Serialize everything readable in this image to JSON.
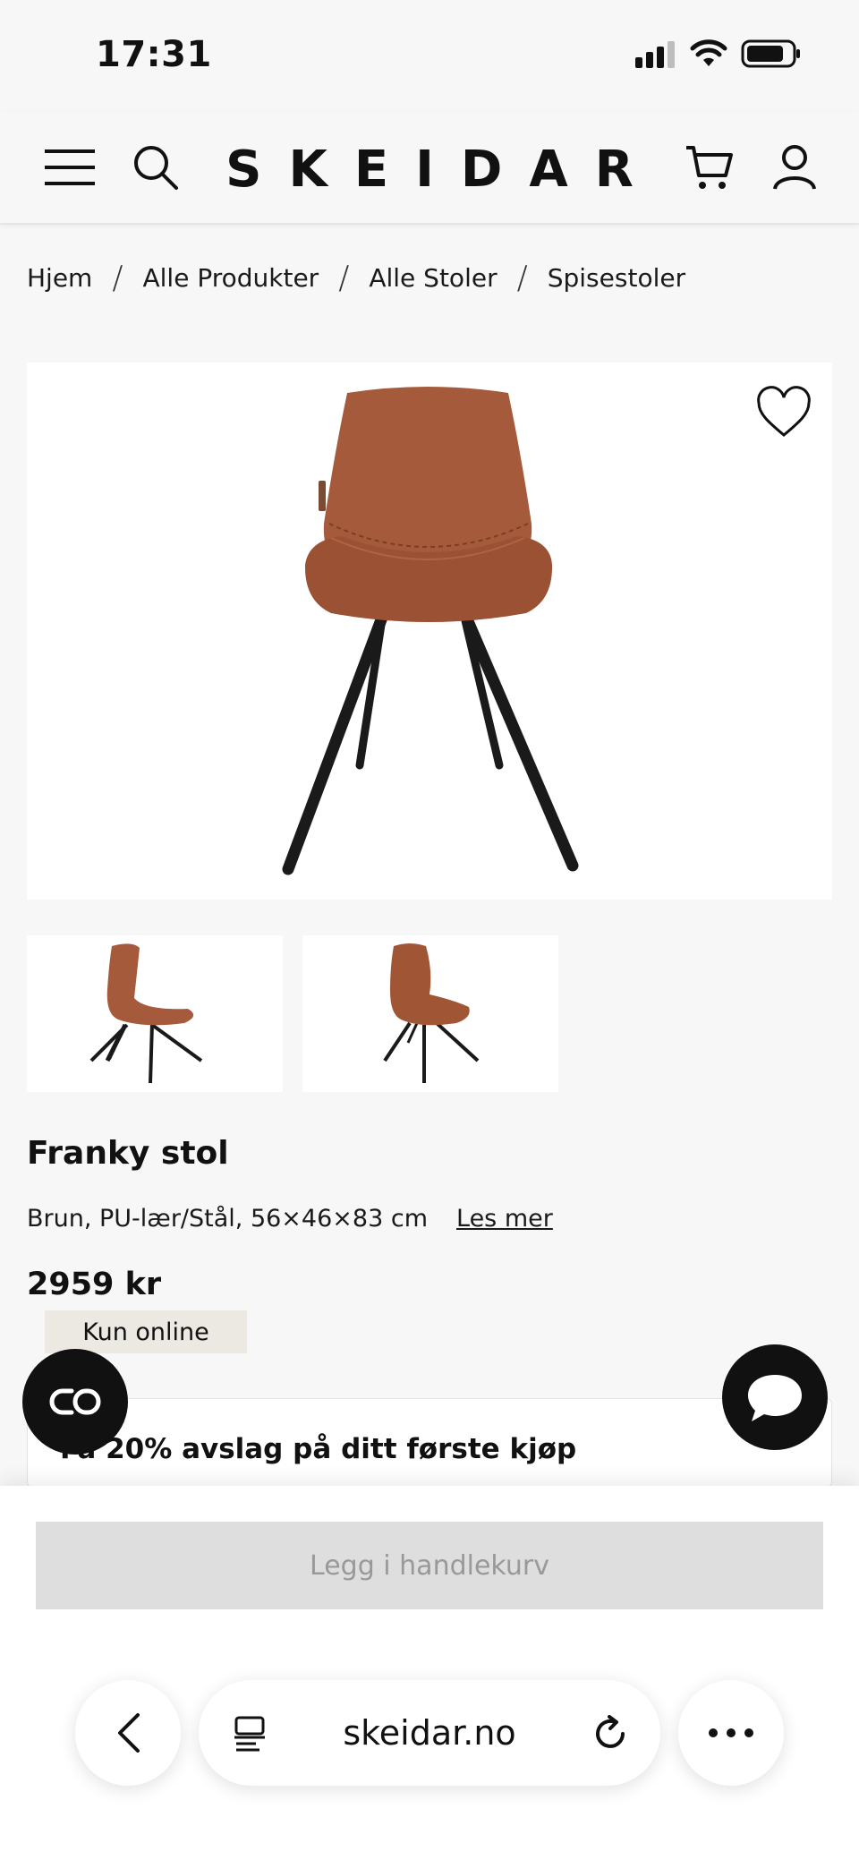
{
  "status_bar": {
    "time": "17:31"
  },
  "header": {
    "logo": "SKEIDAR"
  },
  "breadcrumb": [
    {
      "label": "Hjem"
    },
    {
      "label": "Alle Produkter"
    },
    {
      "label": "Alle Stoler"
    },
    {
      "label": "Spisestoler"
    }
  ],
  "product": {
    "title": "Franky stol",
    "description": "Brun, PU-lær/Stål, 56×46×83 cm",
    "read_more": "Les mer",
    "price": "2959 kr",
    "badge": "Kun online"
  },
  "promo": {
    "text": "Få 20% avslag på ditt første kjøp"
  },
  "cart_button": {
    "label": "Legg i handlekurv"
  },
  "browser": {
    "url": "skeidar.no"
  },
  "colors": {
    "chair_leather": "#a0583a",
    "chair_legs": "#1a1a1a",
    "badge_bg": "#ece9e2"
  }
}
